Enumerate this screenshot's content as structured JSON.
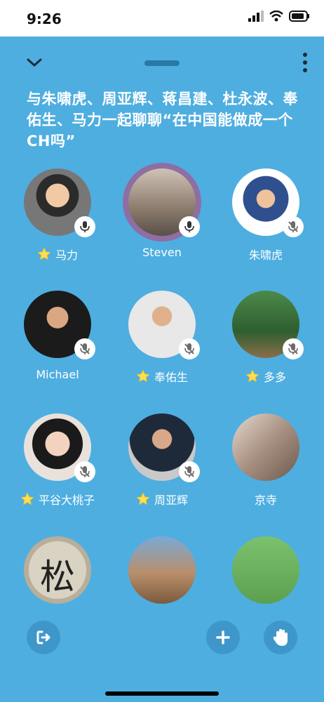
{
  "status_bar": {
    "time": "9:26"
  },
  "room": {
    "title": "与朱啸虎、周亚辉、蒋昌建、杜永波、奉佑生、马力一起聊聊“在中国能做成一个CH吗”"
  },
  "speakers": [
    {
      "name": "马力",
      "moderator": true,
      "muted": false,
      "speaking": false
    },
    {
      "name": "Steven",
      "moderator": false,
      "muted": false,
      "speaking": true
    },
    {
      "name": "朱啸虎",
      "moderator": false,
      "muted": true,
      "speaking": false
    },
    {
      "name": "Michael",
      "moderator": false,
      "muted": true,
      "speaking": false
    },
    {
      "name": "奉佑生",
      "moderator": true,
      "muted": true,
      "speaking": false
    },
    {
      "name": "多多",
      "moderator": true,
      "muted": true,
      "speaking": false
    },
    {
      "name": "平谷大桃子",
      "moderator": true,
      "muted": true,
      "speaking": false
    },
    {
      "name": "周亚辉",
      "moderator": true,
      "muted": true,
      "speaking": false
    },
    {
      "name": "京寺",
      "moderator": false,
      "muted": false,
      "speaking": false
    },
    {
      "name": "",
      "moderator": false,
      "muted": false,
      "speaking": false
    },
    {
      "name": "",
      "moderator": false,
      "muted": false,
      "speaking": false
    },
    {
      "name": "",
      "moderator": false,
      "muted": false,
      "speaking": false
    }
  ],
  "icons": {
    "collapse": "chevron-down-icon",
    "more": "more-vertical-icon",
    "leave": "leave-room-icon",
    "add": "plus-icon",
    "raise_hand": "hand-icon",
    "moderator": "star-icon",
    "mic": "mic-icon",
    "muted": "mic-off-icon"
  },
  "colors": {
    "background": "#4EAEE0",
    "speaking_ring": "#8E6EA3",
    "star": "#FFE04D",
    "button": "#3F97C9"
  }
}
